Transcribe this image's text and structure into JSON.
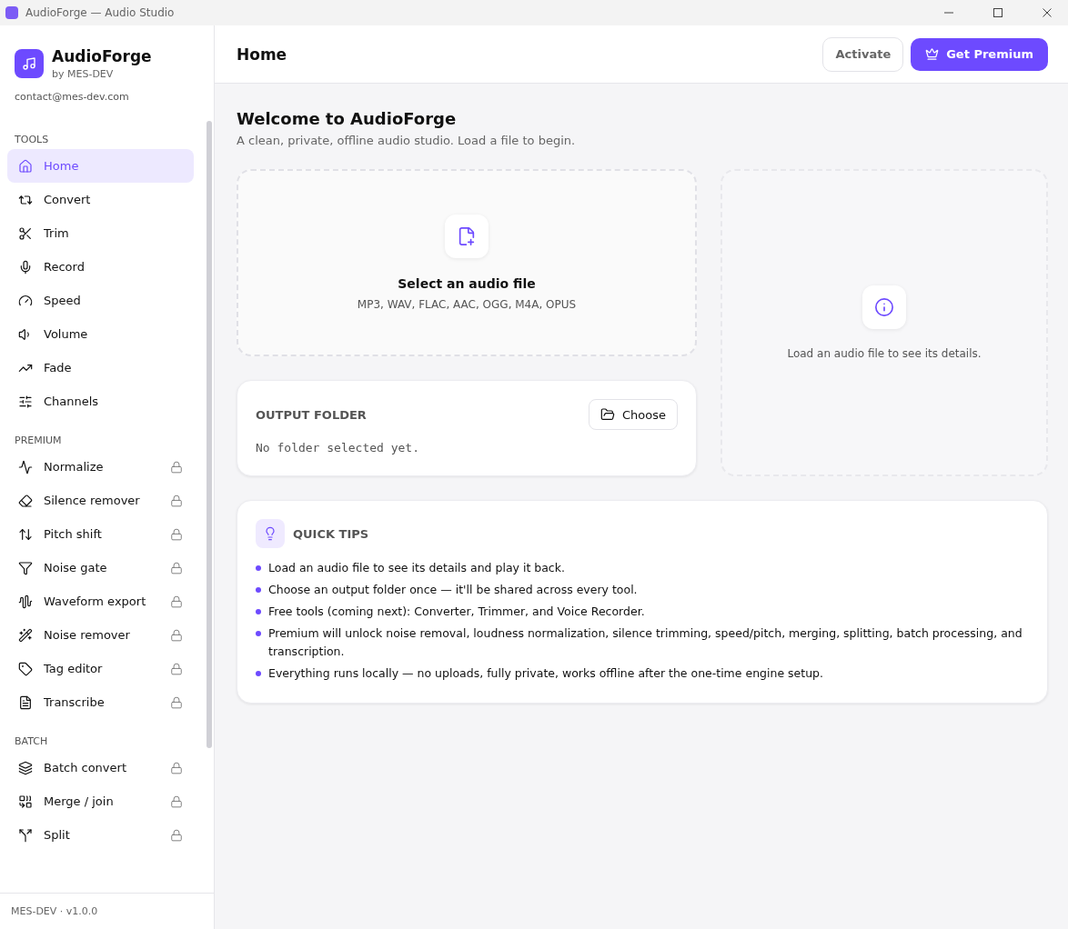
{
  "window": {
    "title": "AudioForge — Audio Studio"
  },
  "brand": {
    "name": "AudioForge",
    "byline": "by MES-DEV",
    "email": "contact@mes-dev.com"
  },
  "sidebar": {
    "sections": [
      {
        "title": "TOOLS",
        "items": [
          {
            "label": "Home",
            "selected": true,
            "locked": false
          },
          {
            "label": "Convert",
            "selected": false,
            "locked": false
          },
          {
            "label": "Trim",
            "selected": false,
            "locked": false
          },
          {
            "label": "Record",
            "selected": false,
            "locked": false
          },
          {
            "label": "Speed",
            "selected": false,
            "locked": false
          },
          {
            "label": "Volume",
            "selected": false,
            "locked": false
          },
          {
            "label": "Fade",
            "selected": false,
            "locked": false
          },
          {
            "label": "Channels",
            "selected": false,
            "locked": false
          }
        ]
      },
      {
        "title": "PREMIUM",
        "items": [
          {
            "label": "Normalize",
            "selected": false,
            "locked": true
          },
          {
            "label": "Silence remover",
            "selected": false,
            "locked": true
          },
          {
            "label": "Pitch shift",
            "selected": false,
            "locked": true
          },
          {
            "label": "Noise gate",
            "selected": false,
            "locked": true
          },
          {
            "label": "Waveform export",
            "selected": false,
            "locked": true
          },
          {
            "label": "Noise remover",
            "selected": false,
            "locked": true
          },
          {
            "label": "Tag editor",
            "selected": false,
            "locked": true
          },
          {
            "label": "Transcribe",
            "selected": false,
            "locked": true
          }
        ]
      },
      {
        "title": "BATCH",
        "items": [
          {
            "label": "Batch convert",
            "selected": false,
            "locked": true
          },
          {
            "label": "Merge / join",
            "selected": false,
            "locked": true
          },
          {
            "label": "Split",
            "selected": false,
            "locked": true
          }
        ]
      }
    ],
    "footer": "MES-DEV · v1.0.0"
  },
  "header": {
    "title": "Home",
    "buttons": [
      "Activate",
      "Get Premium"
    ]
  },
  "welcome": {
    "title": "Welcome to AudioForge",
    "subtitle": "A clean, private, offline audio studio. Load a file to begin."
  },
  "dropzone": {
    "title": "Select an audio file",
    "formats": "MP3, WAV, FLAC, AAC, OGG, M4A, OPUS"
  },
  "output_folder": {
    "title": "OUTPUT FOLDER",
    "button": "Choose",
    "value": "No folder selected yet."
  },
  "details": {
    "message": "Load an audio file to see its details."
  },
  "tips": {
    "title": "QUICK TIPS",
    "items": [
      "Load an audio file to see its details and play it back.",
      "Choose an output folder once — it'll be shared across every tool.",
      "Free tools (coming next): Converter, Trimmer, and Voice Recorder.",
      "Premium will unlock noise removal, loudness normalization, silence trimming, speed/pitch, merging, splitting, batch processing, and transcription.",
      "Everything runs locally — no uploads, fully private, works offline after the one-time engine setup."
    ]
  }
}
